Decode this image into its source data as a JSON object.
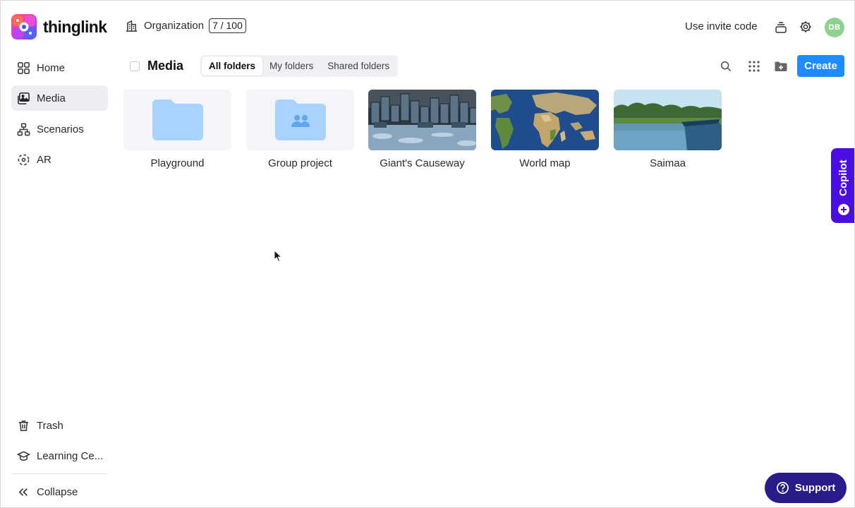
{
  "header": {
    "brand": "thinglink",
    "org_label": "Organization",
    "org_count": "7 / 100",
    "invite_code": "Use invite code",
    "avatar_initials": "DB"
  },
  "sidebar": {
    "items": [
      {
        "label": "Home",
        "icon": "grid-home-icon"
      },
      {
        "label": "Media",
        "icon": "media-icon",
        "active": true
      },
      {
        "label": "Scenarios",
        "icon": "scenarios-icon"
      },
      {
        "label": "AR",
        "icon": "ar-icon"
      }
    ],
    "bottom": [
      {
        "label": "Trash",
        "icon": "trash-icon"
      },
      {
        "label": "Learning Ce...",
        "icon": "learning-center-icon"
      },
      {
        "label": "Collapse",
        "icon": "collapse-icon"
      }
    ]
  },
  "toolbar": {
    "title": "Media",
    "tabs": [
      {
        "label": "All folders",
        "active": true
      },
      {
        "label": "My folders"
      },
      {
        "label": "Shared folders"
      }
    ],
    "create_label": "Create"
  },
  "cards": [
    {
      "label": "Playground",
      "kind": "folder"
    },
    {
      "label": "Group project",
      "kind": "shared-folder"
    },
    {
      "label": "Giant's Causeway",
      "kind": "image"
    },
    {
      "label": "World map",
      "kind": "image"
    },
    {
      "label": "Saimaa",
      "kind": "image"
    }
  ],
  "copilot": {
    "label": "Copilot"
  },
  "support": {
    "label": "Support"
  },
  "colors": {
    "accent": "#1e8cff",
    "copilot": "#4a0fe0",
    "support": "#2a1b8a",
    "avatar": "#8fd28f",
    "folder": "#a8d2ff"
  }
}
